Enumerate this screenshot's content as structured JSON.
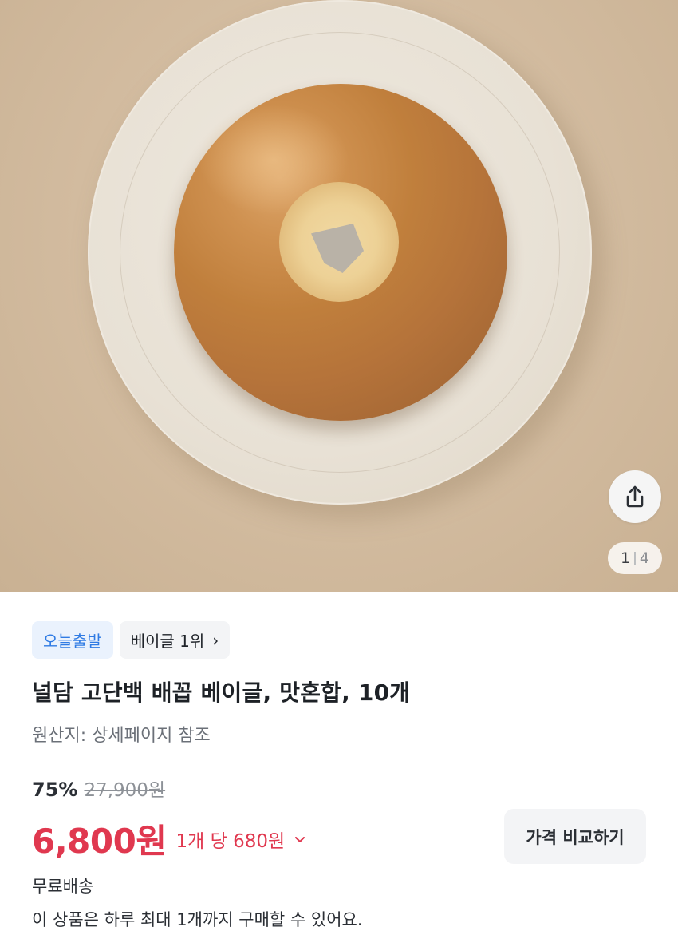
{
  "gallery": {
    "current_page": "1",
    "total_pages": "4",
    "image_alt": "bagel on plate",
    "share_icon": "share-icon"
  },
  "tags": {
    "today_ship": "오늘출발",
    "rank": "베이글 1위",
    "rank_chevron": "›"
  },
  "product": {
    "title": "널담 고단백 배꼽 베이글, 맛혼합, 10개",
    "origin": "원산지: 상세페이지 참조"
  },
  "pricing": {
    "discount": "75%",
    "original_price": "27,900원",
    "price": "6,800원",
    "unit_price": "1개 당 680원",
    "compare_label": "가격 비교하기",
    "accent_color": "#e0384f"
  },
  "shipping": {
    "label": "무료배송",
    "purchase_limit": "이 상품은 하루 최대 1개까지 구매할 수 있어요."
  }
}
